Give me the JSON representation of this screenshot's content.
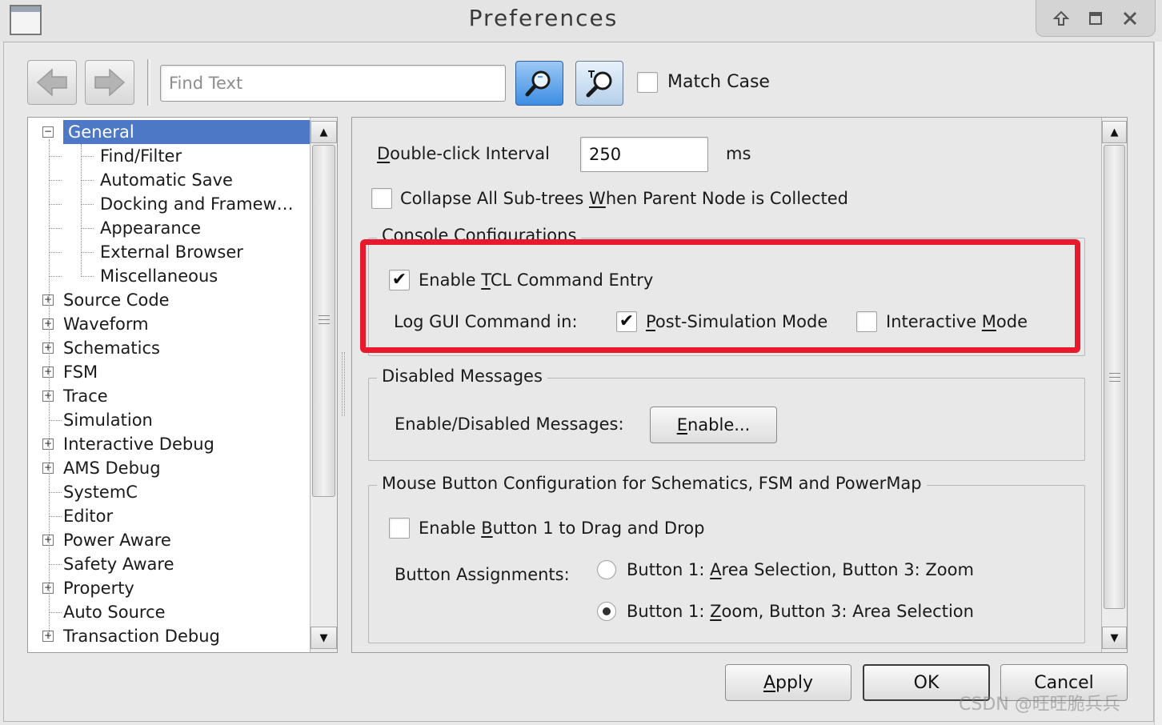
{
  "window": {
    "title": "Preferences"
  },
  "toolbar": {
    "find_placeholder": "Find Text",
    "match_case_label": "Match Case",
    "match_case_checked": false
  },
  "tree": {
    "items": [
      {
        "label": "General",
        "level": 0,
        "expander": "minus",
        "selected": true
      },
      {
        "label": "Find/Filter",
        "level": 1
      },
      {
        "label": "Automatic Save",
        "level": 1
      },
      {
        "label": "Docking and Framew…",
        "level": 1
      },
      {
        "label": "Appearance",
        "level": 1
      },
      {
        "label": "External Browser",
        "level": 1
      },
      {
        "label": "Miscellaneous",
        "level": 1
      },
      {
        "label": "Source Code",
        "level": 0,
        "expander": "plus"
      },
      {
        "label": "Waveform",
        "level": 0,
        "expander": "plus"
      },
      {
        "label": "Schematics",
        "level": 0,
        "expander": "plus"
      },
      {
        "label": "FSM",
        "level": 0,
        "expander": "plus"
      },
      {
        "label": "Trace",
        "level": 0,
        "expander": "plus"
      },
      {
        "label": "Simulation",
        "level": 0
      },
      {
        "label": "Interactive Debug",
        "level": 0,
        "expander": "plus"
      },
      {
        "label": "AMS Debug",
        "level": 0,
        "expander": "plus"
      },
      {
        "label": "SystemC",
        "level": 0
      },
      {
        "label": "Editor",
        "level": 0
      },
      {
        "label": "Power Aware",
        "level": 0,
        "expander": "plus"
      },
      {
        "label": "Safety Aware",
        "level": 0
      },
      {
        "label": "Property",
        "level": 0,
        "expander": "plus"
      },
      {
        "label": "Auto Source",
        "level": 0
      },
      {
        "label": "Transaction Debug",
        "level": 0,
        "expander": "plus"
      }
    ]
  },
  "general": {
    "double_click_label": "Double-click Interval",
    "double_click_value": "250",
    "double_click_unit": "ms",
    "collapse_label": "Collapse All Sub-trees When Parent Node is Collected",
    "collapse_checked": false
  },
  "console": {
    "group_title": "Console Configurations",
    "tcl_label": "Enable TCL Command Entry",
    "tcl_checked": true,
    "log_label": "Log GUI Command in:",
    "post_sim_label": "Post-Simulation Mode",
    "post_sim_checked": true,
    "interactive_label": "Interactive Mode",
    "interactive_checked": false
  },
  "disabled_messages": {
    "group_title": "Disabled Messages",
    "label": "Enable/Disabled Messages:",
    "button_label": "Enable..."
  },
  "mouse": {
    "group_title": "Mouse Button Configuration for Schematics, FSM and PowerMap",
    "drag_label": "Enable Button 1 to Drag and Drop",
    "drag_checked": false,
    "assign_label": "Button Assignments:",
    "option1_label": "Button 1: Area Selection, Button 3: Zoom",
    "option2_label": "Button 1: Zoom, Button 3: Area Selection",
    "selected_option": 2
  },
  "buttons": {
    "apply": "Apply",
    "ok": "OK",
    "cancel": "Cancel"
  },
  "watermark": "CSDN @旺旺脆兵兵",
  "colors": {
    "highlight": "#e8192c",
    "selection": "#4c78c6"
  },
  "icons": [
    "window-menu-icon",
    "maximize-up-icon",
    "restore-icon",
    "close-icon",
    "back-arrow-icon",
    "forward-arrow-icon",
    "find-search-icon",
    "find-highlight-icon",
    "scroll-up-icon",
    "scroll-down-icon"
  ]
}
